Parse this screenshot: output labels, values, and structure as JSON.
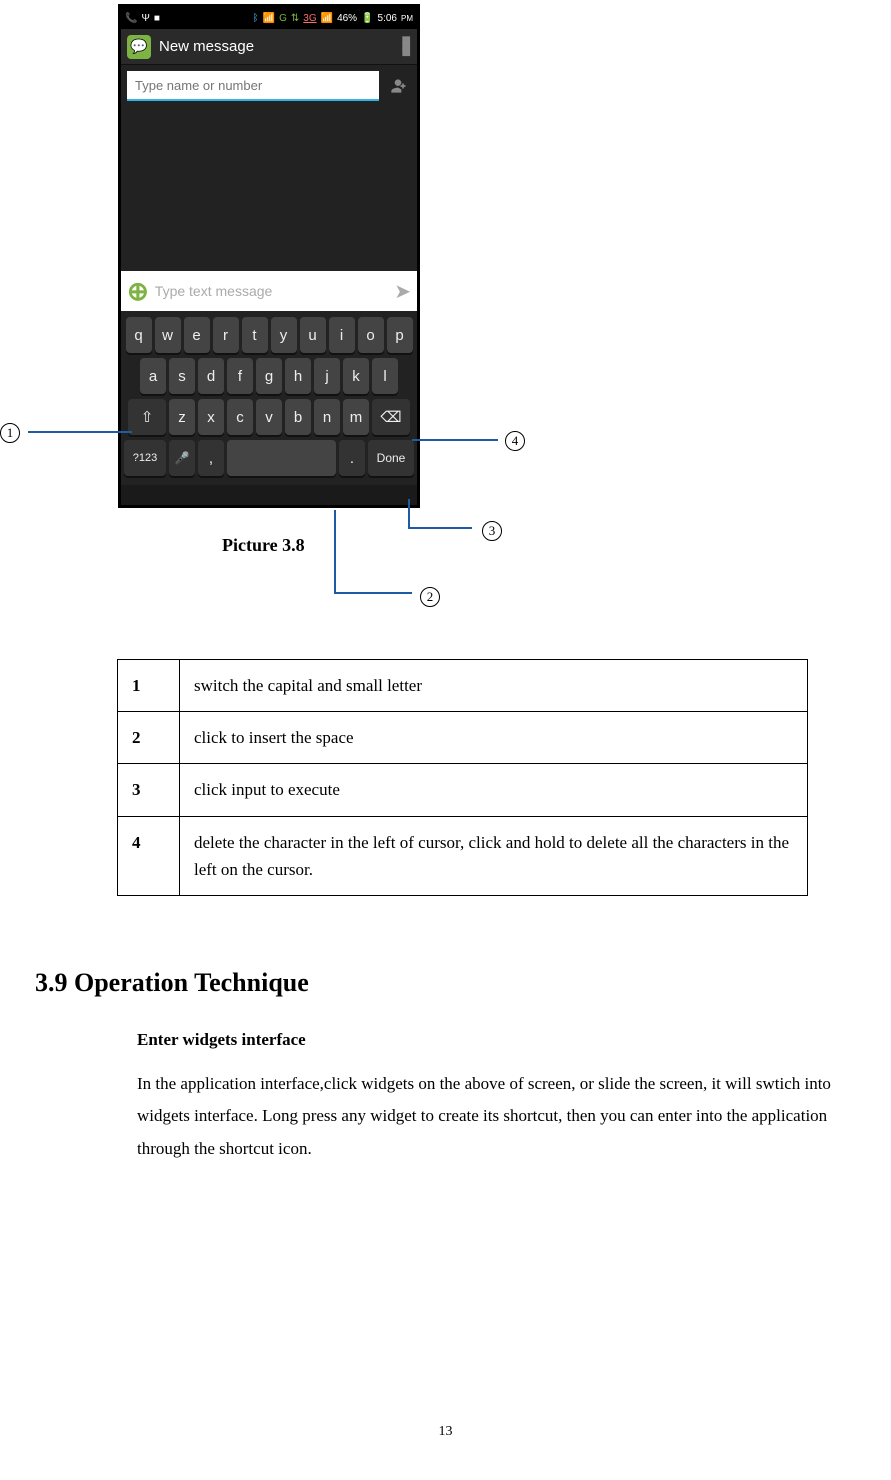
{
  "phone": {
    "statusbar": {
      "left_icons": [
        "phone-icon",
        "psi-icon",
        "square-icon"
      ],
      "bluetooth": "bluetooth-icon",
      "wifi": "wifi-icon",
      "network_g": "G",
      "network_3g": "3G",
      "signal": "signal-icon",
      "battery_pct": "46%",
      "battery": "battery-icon",
      "time": "5:06",
      "ampm": "PM"
    },
    "appbar": {
      "title": "New message",
      "menu_label": "⋮"
    },
    "recipient_placeholder": "Type name or number",
    "compose_placeholder": "Type text message",
    "keys": {
      "row1": [
        "q",
        "w",
        "e",
        "r",
        "t",
        "y",
        "u",
        "i",
        "o",
        "p"
      ],
      "row2": [
        "a",
        "s",
        "d",
        "f",
        "g",
        "h",
        "j",
        "k",
        "l"
      ],
      "row3_shift": "⇧",
      "row3": [
        "z",
        "x",
        "c",
        "v",
        "b",
        "n",
        "m"
      ],
      "row3_del": "⌫",
      "row4_sym": "?123",
      "row4_mic": "🎤",
      "row4_comma": ",",
      "row4_space": " ",
      "row4_period": ".",
      "row4_done": "Done"
    }
  },
  "callouts": {
    "c1": "1",
    "c2": "2",
    "c3": "3",
    "c4": "4"
  },
  "caption": "Picture 3.8",
  "table": {
    "rows": [
      {
        "n": "1",
        "d": "switch the capital and small letter"
      },
      {
        "n": "2",
        "d": "click to insert the space"
      },
      {
        "n": "3",
        "d": "click input to execute"
      },
      {
        "n": "4",
        "d": "delete the character in the left of cursor, click and hold to delete all the characters in the left on the cursor."
      }
    ]
  },
  "section": {
    "heading": "3.9 Operation Technique",
    "subheading": "Enter widgets interface",
    "paragraph": "In the application interface,click widgets on the above of screen, or slide the screen, it will swtich into widgets interface. Long press any widget to create its shortcut, then you can enter into the application through the shortcut icon."
  },
  "page_number": "13"
}
